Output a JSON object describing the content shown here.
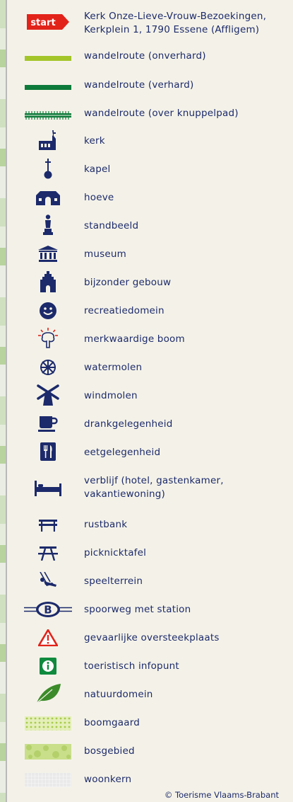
{
  "legend": {
    "start_badge": "start",
    "items": [
      {
        "icon": "start-flag-icon",
        "label": "Kerk Onze-Lieve-Vrouw-Bezoekingen, Kerkplein 1, 1790 Essene (Affligem)"
      },
      {
        "icon": "unpaved-route-line-icon",
        "label": "wandelroute (onverhard)"
      },
      {
        "icon": "paved-route-line-icon",
        "label": "wandelroute (verhard)"
      },
      {
        "icon": "boardwalk-route-line-icon",
        "label": "wandelroute (over knuppelpad)"
      },
      {
        "icon": "church-icon",
        "label": "kerk"
      },
      {
        "icon": "chapel-icon",
        "label": "kapel"
      },
      {
        "icon": "farm-icon",
        "label": "hoeve"
      },
      {
        "icon": "statue-icon",
        "label": "standbeeld"
      },
      {
        "icon": "museum-icon",
        "label": "museum"
      },
      {
        "icon": "special-building-icon",
        "label": "bijzonder gebouw"
      },
      {
        "icon": "smiley-icon",
        "label": "recreatiedomein"
      },
      {
        "icon": "remarkable-tree-icon",
        "label": "merkwaardige boom"
      },
      {
        "icon": "watermill-icon",
        "label": "watermolen"
      },
      {
        "icon": "windmill-icon",
        "label": "windmolen"
      },
      {
        "icon": "cup-icon",
        "label": "drankgelegenheid"
      },
      {
        "icon": "fork-knife-icon",
        "label": "eetgelegenheid"
      },
      {
        "icon": "bed-icon",
        "label": "verblijf (hotel, gastenkamer, vakantiewoning)"
      },
      {
        "icon": "bench-icon",
        "label": "rustbank"
      },
      {
        "icon": "picnic-table-icon",
        "label": "picknicktafel"
      },
      {
        "icon": "playground-icon",
        "label": "speelterrein"
      },
      {
        "icon": "railway-station-icon",
        "label": "spoorweg met station"
      },
      {
        "icon": "warning-triangle-icon",
        "label": "gevaarlijke oversteekplaats"
      },
      {
        "icon": "info-icon",
        "label": "toeristisch infopunt"
      },
      {
        "icon": "leaf-icon",
        "label": "natuurdomein"
      },
      {
        "icon": "orchard-swatch-icon",
        "label": "boomgaard"
      },
      {
        "icon": "forest-swatch-icon",
        "label": "bosgebied"
      },
      {
        "icon": "residential-swatch-icon",
        "label": "woonkern"
      }
    ]
  },
  "credit": "© Toerisme Vlaams-Brabant",
  "colors": {
    "text": "#1c2a6b",
    "icon": "#1c2a6b",
    "start_red": "#e2231a",
    "route_unpaved": "#a4c52a",
    "route_paved": "#0d7a3a",
    "info_green": "#0f8a3e",
    "leaf_green": "#3c8b2a",
    "background": "#f4f2e8"
  }
}
